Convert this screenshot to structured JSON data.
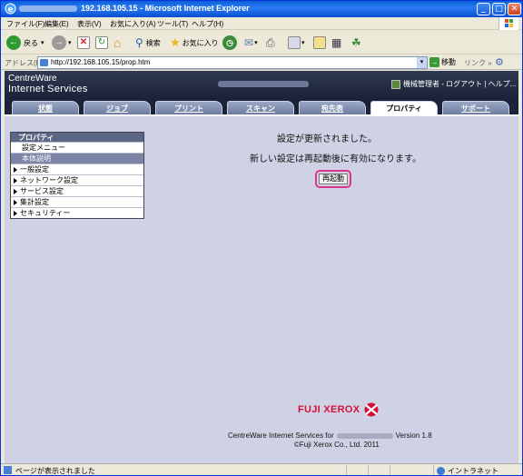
{
  "window": {
    "title_ip": "192.168.105.15",
    "title_suffix": "- Microsoft Internet Explorer"
  },
  "menubar": {
    "items": [
      "ファイル(F)",
      "編集(E)",
      "表示(V)",
      "お気に入り(A)",
      "ツール(T)",
      "ヘルプ(H)"
    ]
  },
  "toolbar": {
    "back_label": "戻る",
    "search_label": "検索",
    "favorites_label": "お気に入り"
  },
  "address": {
    "label": "アドレス(D)",
    "url": "http://192.168.105.15/prop.htm",
    "go_label": "移動",
    "links_label": "リンク"
  },
  "header": {
    "brand_line1": "CentreWare",
    "brand_line2": "Internet Services",
    "admin_text": "機械管理者 - ログアウト | ヘルプ..."
  },
  "tabs": [
    "状態",
    "ジョブ",
    "プリント",
    "スキャン",
    "宛先表",
    "プロパティ",
    "サポート"
  ],
  "active_tab": "プロパティ",
  "sidebar": {
    "header": "プロパティ",
    "items": [
      {
        "label": "設定メニュー",
        "type": "item"
      },
      {
        "label": "本体説明",
        "type": "item-selected"
      },
      {
        "label": "一般設定",
        "type": "group"
      },
      {
        "label": "ネットワーク設定",
        "type": "group"
      },
      {
        "label": "サービス設定",
        "type": "group"
      },
      {
        "label": "集計設定",
        "type": "group"
      },
      {
        "label": "セキュリティー",
        "type": "group"
      }
    ]
  },
  "main": {
    "message1": "設定が更新されました。",
    "message2": "新しい設定は再起動後に有効になります。",
    "reboot_button": "再起動"
  },
  "footer": {
    "logo_text": "FUJI XEROX",
    "line1_prefix": "CentreWare Internet Services for",
    "line1_suffix": "Version 1.8",
    "copyright": "©Fuji Xerox Co., Ltd. 2011"
  },
  "status": {
    "text": "ページが表示されました",
    "zone": "イントラネット"
  },
  "colors": {
    "accent_pink": "#e0358c",
    "header_dark": "#1c2338",
    "logo_red": "#d4103a"
  }
}
